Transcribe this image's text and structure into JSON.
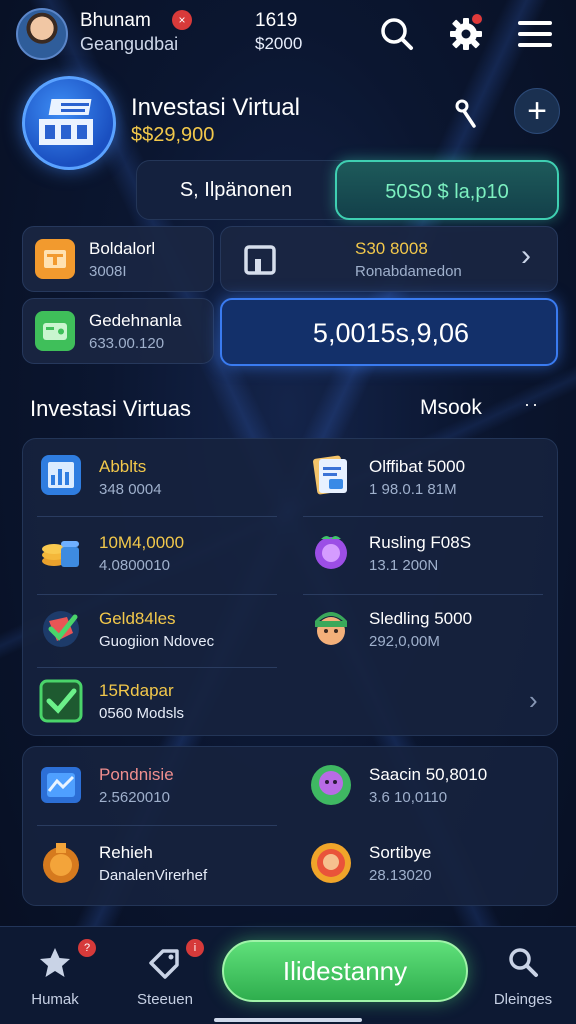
{
  "header": {
    "user_name": "Bhunam",
    "user_sub": "Geangudbai",
    "notification_badge": "×",
    "stat_num": "1619",
    "stat_amount": "$2000"
  },
  "hero": {
    "title": "Investasi Virtual",
    "amount": "$$29,900",
    "add_label": "+",
    "toggle_left": "S, Ilpänonen",
    "toggle_right": "50S0 $ la,p10"
  },
  "stats": {
    "card_a": {
      "label": "Boldalorl",
      "sub": "3008I"
    },
    "card_b": {
      "label": "S30 8008",
      "sub": "Ronabdamedon"
    },
    "card_c": {
      "label": "Gedehnanla",
      "sub": "633.00.120"
    },
    "card_d": {
      "amount": "5,0015s,9,06"
    }
  },
  "section": {
    "title": "Investasi Virtuas",
    "more": "Msook",
    "dots": "··"
  },
  "list_panel_1": [
    {
      "title": "Abblts",
      "sub": "348 0004",
      "title_color": "#f2c84b"
    },
    {
      "title": "Olffibat 5000",
      "sub": "1 98.0.1 81M",
      "title_color": "#ffffff"
    },
    {
      "title": "10M4,0000",
      "sub": "4.0800010",
      "title_color": "#f2c84b"
    },
    {
      "title": "Rusling F08S",
      "sub": "13.1 200N",
      "title_color": "#ffffff"
    },
    {
      "title": "Geld84les",
      "sub": "Guogiion Ndovec",
      "title_color": "#f2c84b"
    },
    {
      "title": "Sledling 5000",
      "sub": "292,0,00M",
      "title_color": "#ffffff"
    },
    {
      "title": "15Rdapar",
      "sub": "0560 Modsls",
      "title_color": "#f2c84b"
    }
  ],
  "list_panel_2": [
    {
      "title": "Pondnisie",
      "sub": "2.5620010",
      "title_color": "#ef8e8e"
    },
    {
      "title": "Saacin 50,8010",
      "sub": "3.6 10,0110",
      "title_color": "#ffffff"
    },
    {
      "title": "Rehieh",
      "sub": "DanalenVirerhef",
      "title_color": "#ffffff"
    },
    {
      "title": "Sortibye",
      "sub": "28.13020",
      "title_color": "#ffffff"
    }
  ],
  "bottom_nav": {
    "home_label": "Humak",
    "home_badge": "?",
    "steps_label": "Steeuen",
    "steps_badge": "i",
    "cta_label": "Ilidestanny",
    "search_label": "Dleinges"
  },
  "colors": {
    "accent_blue": "#3a7bf0",
    "accent_green": "#3fd0b2",
    "gold": "#f2c84b",
    "cta_green": "#4cc865"
  },
  "icons": {
    "header": [
      "search-icon",
      "gear-icon",
      "menu-icon"
    ],
    "hero": [
      "building-chart-icon",
      "pin-icon",
      "plus-icon"
    ],
    "nav": [
      "star-icon",
      "tag-icon",
      "search-icon"
    ]
  }
}
